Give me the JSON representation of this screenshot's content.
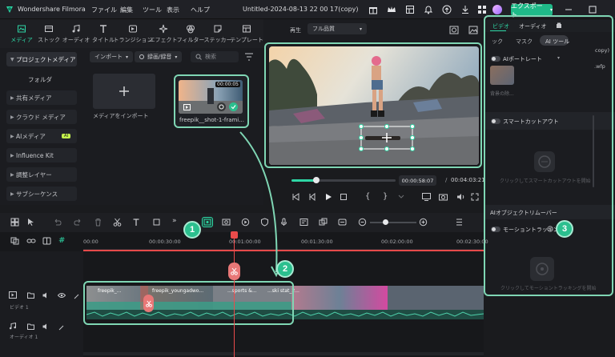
{
  "window": {
    "app_name": "Wondershare Filmora",
    "menus": [
      "ファイル",
      "編集",
      "ツール",
      "表示",
      "ヘルプ"
    ],
    "project_title": "Untitled-2024-08-13 22 00 17(copy)",
    "export_label": "エクスポート"
  },
  "toolbar": {
    "tabs": [
      {
        "label": "メディア",
        "icon": "media-icon"
      },
      {
        "label": "ストック",
        "icon": "stock-icon"
      },
      {
        "label": "オーディオ",
        "icon": "audio-icon"
      },
      {
        "label": "タイトル",
        "icon": "title-icon"
      },
      {
        "label": "トランジション",
        "icon": "transition-icon"
      },
      {
        "label": "エフェクト",
        "icon": "effect-icon"
      },
      {
        "label": "フィルター",
        "icon": "filter-icon"
      },
      {
        "label": "ステッカー",
        "icon": "sticker-icon"
      },
      {
        "label": "テンプレート",
        "icon": "template-icon"
      }
    ]
  },
  "sidebar": {
    "items": [
      {
        "label": "プロジェクトメディア"
      },
      {
        "label": "フォルダ"
      },
      {
        "label": "共有メディア"
      },
      {
        "label": "クラウド メディア"
      },
      {
        "label": "AIメディア",
        "badge": "AI"
      },
      {
        "label": "Influence Kit"
      },
      {
        "label": "調整レイヤー"
      },
      {
        "label": "サブシーケンス"
      }
    ]
  },
  "media": {
    "import_label": "インポート",
    "record_label": "録画/録音",
    "search_placeholder": "検索",
    "import_tile_label": "メディアをインポート",
    "clip_duration": "00:00:05",
    "clip_name": "freepik__shot-1-frami..."
  },
  "player": {
    "playback_label": "再生",
    "quality_label": "フル品質",
    "current_time": "00:00:58:07",
    "separator": "/",
    "total_time": "00:04:03:21"
  },
  "right_panel": {
    "tabs": [
      "ビデオ",
      "オーディオ"
    ],
    "subtabs": [
      "ック",
      "マスク",
      "AI ツール"
    ],
    "filename_fragment_1": "copy)",
    "filename_fragment_2": ".wfp",
    "ai_portrait_label": "AIポートレート",
    "portrait_caption": "背景の除...",
    "smart_cutout_label": "スマートカットアウト",
    "smart_cutout_hint": "クリックしてスマートカットアウトを開始",
    "ai_object_remover_label": "AIオブジェクトリムーバー",
    "motion_tracking_label": "モーショントラッキング",
    "motion_tracking_hint": "クリックしてモーショントラッキングを開始"
  },
  "timeline": {
    "ruler": [
      "00:00",
      "00:00:30:00",
      "00:01:00:00",
      "00:01:30:00",
      "00:02:00:00",
      "00:02:30:00"
    ],
    "video_track_label": "ビデオ 1",
    "audio_track_label": "オーディオ 1",
    "clip_texts": [
      "freepik_...",
      "freepik_youngadwo...",
      "...sports &...",
      "...ski stat_2..."
    ]
  },
  "callouts": [
    "1",
    "2",
    "3"
  ],
  "colors": {
    "accent": "#2ed6a5",
    "callout_green": "#2bbf8e",
    "playhead": "#ea4b4b",
    "clip_teal": "#3e9a86"
  }
}
